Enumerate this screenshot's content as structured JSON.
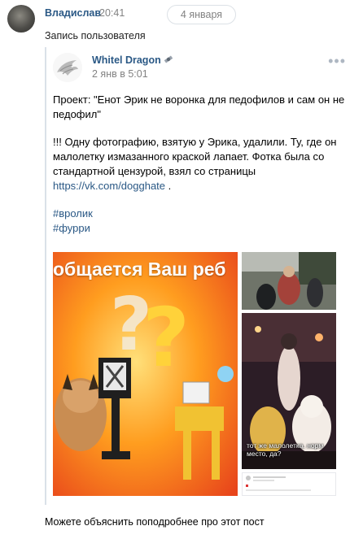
{
  "message": {
    "sender": "Владислав",
    "time": "20:41",
    "date_divider": "4 января",
    "repost_label": "Запись пользователя"
  },
  "post": {
    "author": "Whitel Dragon",
    "date": "2 янв в 5:01",
    "line1": "Проект: \"Енот Эрик не воронка для педофилов и сам он не педофил\"",
    "line2": "!!! Одну фотографию, взятую у Эрика, удалили. Ту, где он малолетку измазанного краской лапает. Фотка была со стандартной цензурой, взял со страницы",
    "link": "https://vk.com/dogghate",
    "after_link": " .",
    "hashtag1": "#вролик",
    "hashtag2": "#фурри",
    "images": {
      "main_caption": "общается Ваш реб",
      "side_caption": "тот же малолетка. норм место, да?"
    }
  },
  "reply": "Можете объяснить поподробнее про этот пост",
  "colors": {
    "link": "#2a5885",
    "muted": "#828282",
    "border": "#dae1e8"
  }
}
